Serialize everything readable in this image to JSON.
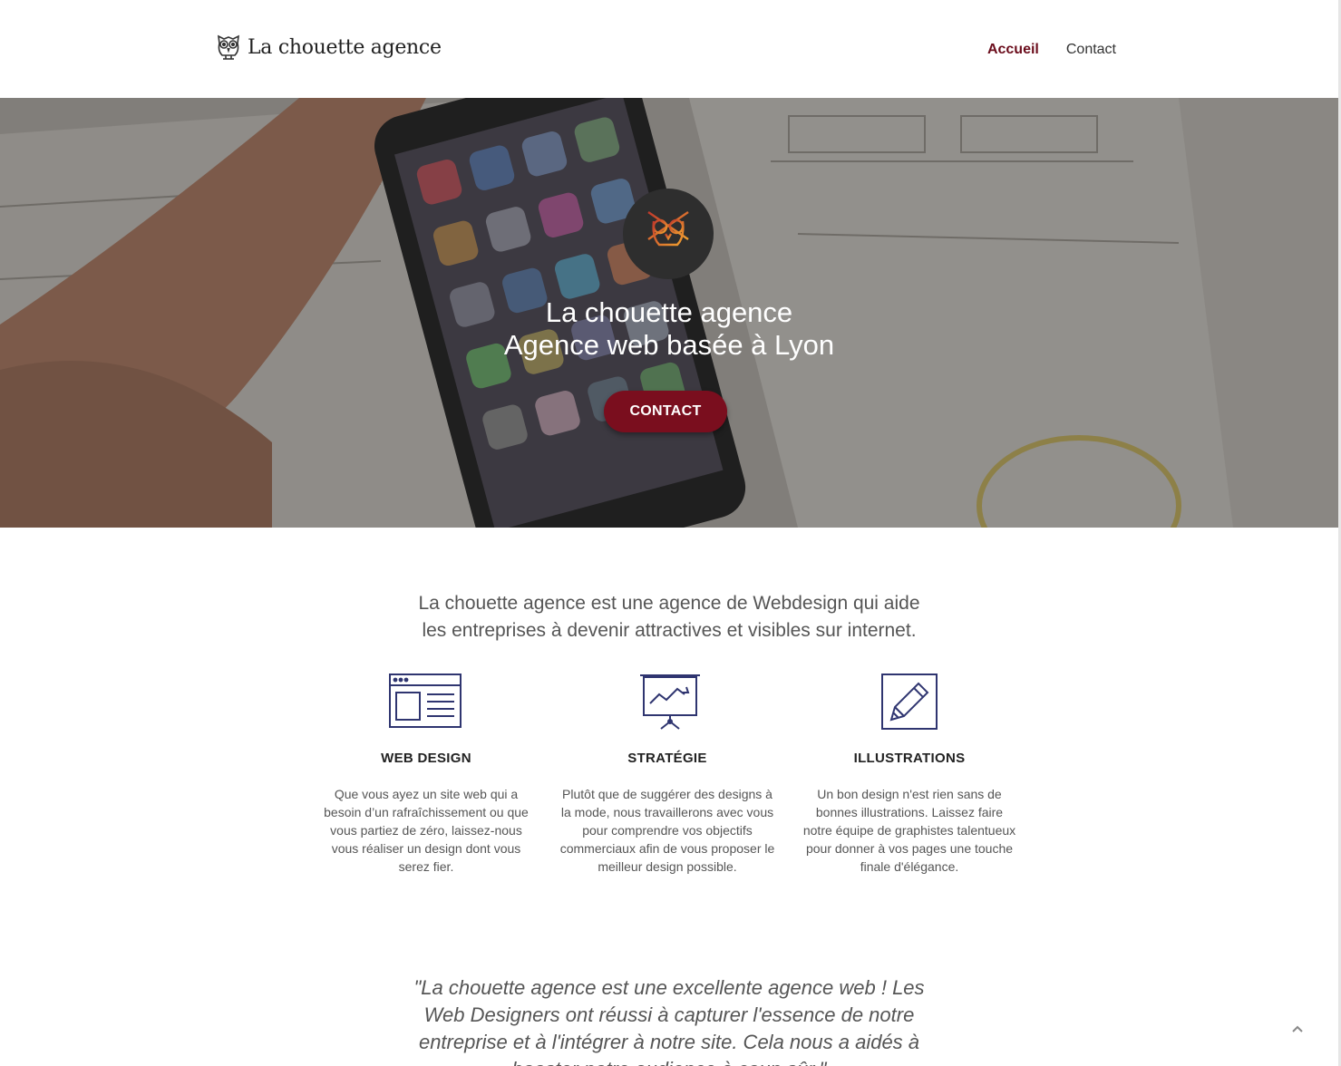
{
  "brand": {
    "name": "La chouette agence",
    "accent": "#6b0d1c"
  },
  "nav": {
    "items": [
      {
        "label": "Accueil",
        "active": true
      },
      {
        "label": "Contact",
        "active": false
      }
    ]
  },
  "hero": {
    "title_line1": "La chouette agence",
    "title_line2": "Agence web basée à Lyon",
    "cta_label": "CONTACT",
    "logo_icon": "owl-icon"
  },
  "intro": {
    "line1": "La chouette agence est une agence de Webdesign qui aide",
    "line2": "les entreprises à devenir attractives et visibles sur internet."
  },
  "features": [
    {
      "icon": "web-design-icon",
      "title": "WEB DESIGN",
      "lines": [
        "Que vous ayez un site web qui a",
        "besoin d’un rafraîchissement ou que",
        "vous partiez de zéro, laissez-nous",
        "vous réaliser un design dont vous",
        "serez fier."
      ]
    },
    {
      "icon": "strategy-icon",
      "title": "STRATÉGIE",
      "lines": [
        "Plutôt que de suggérer des designs à",
        "la mode, nous travaillerons avec vous",
        "pour comprendre vos objectifs",
        "commerciaux afin de vous proposer le",
        "meilleur design possible."
      ]
    },
    {
      "icon": "illustration-icon",
      "title": "ILLUSTRATIONS",
      "lines": [
        "Un bon design n'est rien sans de",
        "bonnes illustrations. Laissez faire",
        "notre équipe de graphistes talentueux",
        "pour donner à vos pages une touche",
        "finale d'élégance."
      ]
    }
  ],
  "testimonial": {
    "lines": [
      "\"La chouette agence est une excellente agence web ! Les",
      "Web Designers ont réussi à capturer l'essence de notre",
      "entreprise et à l'intégrer à notre site. Cela nous a aidés à",
      "booster notre audience à coup sûr.\""
    ]
  },
  "scroll_top": {
    "icon": "chevron-up-icon"
  }
}
